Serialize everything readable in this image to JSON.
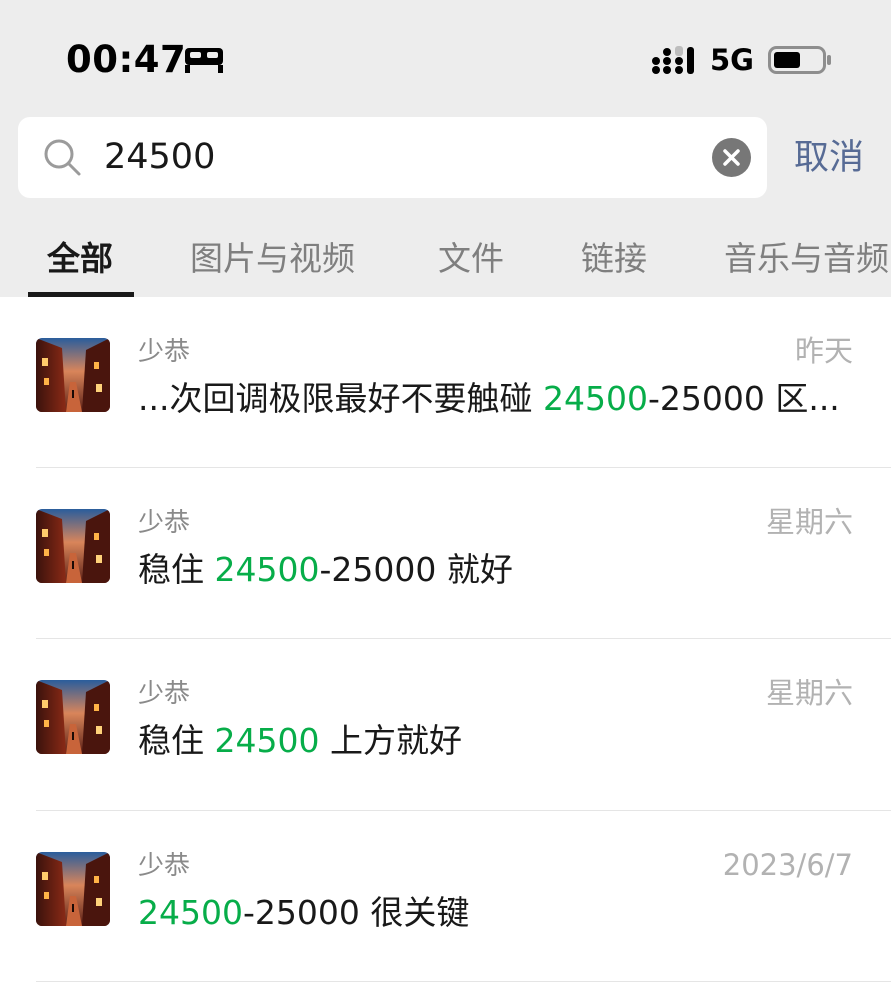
{
  "status_bar": {
    "time": "00:47",
    "sleep_icon": "bed-icon",
    "signal_icon": "cellular-signal-icon",
    "network": "5G",
    "battery_icon": "battery-icon"
  },
  "search": {
    "query": "24500",
    "icon": "search-icon",
    "clear_icon": "clear-icon",
    "cancel_label": "取消"
  },
  "tabs": [
    {
      "label": "全部",
      "active": true
    },
    {
      "label": "图片与视频",
      "active": false
    },
    {
      "label": "文件",
      "active": false
    },
    {
      "label": "链接",
      "active": false
    },
    {
      "label": "音乐与音频",
      "active": false
    }
  ],
  "colors": {
    "highlight": "#07ad49",
    "cancel": "#576b95",
    "header_bg": "#ededed"
  },
  "results": [
    {
      "sender": "少恭",
      "date": "昨天",
      "snippet_before": "...次回调极限最好不要触碰 ",
      "snippet_match": "24500",
      "snippet_after": "-25000 区..."
    },
    {
      "sender": "少恭",
      "date": "星期六",
      "snippet_before": "稳住 ",
      "snippet_match": "24500",
      "snippet_after": "-25000 就好"
    },
    {
      "sender": "少恭",
      "date": "星期六",
      "snippet_before": "稳住 ",
      "snippet_match": "24500",
      "snippet_after": " 上方就好"
    },
    {
      "sender": "少恭",
      "date": "2023/6/7",
      "snippet_before": "",
      "snippet_match": "24500",
      "snippet_after": "-25000 很关键"
    }
  ]
}
